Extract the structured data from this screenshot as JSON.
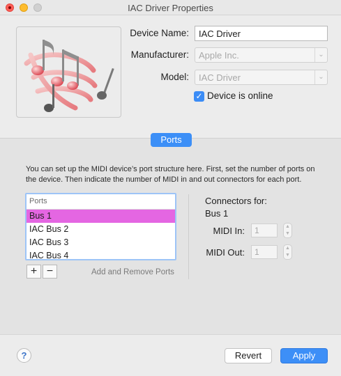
{
  "window": {
    "title": "IAC Driver Properties"
  },
  "device": {
    "name_label": "Device Name:",
    "name_value": "IAC Driver",
    "manufacturer_label": "Manufacturer:",
    "manufacturer_value": "Apple Inc.",
    "model_label": "Model:",
    "model_value": "IAC Driver",
    "online_label": "Device is online",
    "online_checked": true,
    "icon": "midi-notes-icon"
  },
  "tabs": [
    {
      "label": "Ports",
      "selected": true
    }
  ],
  "ports": {
    "description": "You can set up the MIDI device’s port structure here. First, set the number of ports on the device. Then indicate the number of MIDI in and out connectors for each port.",
    "list_header": "Ports",
    "items": [
      {
        "label": "Bus 1",
        "selected": true
      },
      {
        "label": "IAC Bus 2",
        "selected": false
      },
      {
        "label": "IAC Bus 3",
        "selected": false
      },
      {
        "label": "IAC Bus 4",
        "selected": false
      }
    ],
    "add_label": "+",
    "remove_label": "−",
    "add_remove_caption": "Add and Remove Ports"
  },
  "connectors": {
    "title": "Connectors for:",
    "bus": "Bus 1",
    "midi_in_label": "MIDI In:",
    "midi_in_value": "1",
    "midi_out_label": "MIDI Out:",
    "midi_out_value": "1"
  },
  "footer": {
    "help_label": "?",
    "revert_label": "Revert",
    "apply_label": "Apply"
  },
  "colors": {
    "accent": "#3c8ff7",
    "selection": "#e466e2"
  }
}
